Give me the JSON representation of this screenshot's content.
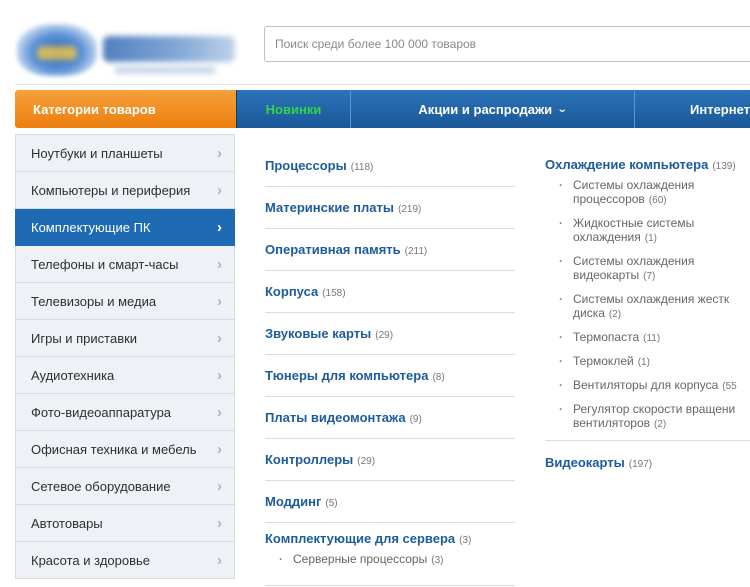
{
  "search": {
    "placeholder": "Поиск среди более 100 000 товаров"
  },
  "nav": {
    "categories": "Категории товаров",
    "new": "Новинки",
    "sales": "Акции и распродажи",
    "internet": "Интернет"
  },
  "sidebar": {
    "items": [
      {
        "label": "Ноутбуки и планшеты",
        "active": false
      },
      {
        "label": "Компьютеры и периферия",
        "active": false
      },
      {
        "label": "Комплектующие ПК",
        "active": true
      },
      {
        "label": "Телефоны и смарт-часы",
        "active": false
      },
      {
        "label": "Телевизоры и медиа",
        "active": false
      },
      {
        "label": "Игры и приставки",
        "active": false
      },
      {
        "label": "Аудиотехника",
        "active": false
      },
      {
        "label": "Фото-видеоаппаратура",
        "active": false
      },
      {
        "label": "Офисная техника и мебель",
        "active": false
      },
      {
        "label": "Сетевое оборудование",
        "active": false
      },
      {
        "label": "Автотовары",
        "active": false
      },
      {
        "label": "Красота и здоровье",
        "active": false
      }
    ]
  },
  "col1": {
    "items": [
      {
        "label": "Процессоры",
        "count": "(118)"
      },
      {
        "label": "Материнские платы",
        "count": "(219)"
      },
      {
        "label": "Оперативная память",
        "count": "(211)"
      },
      {
        "label": "Корпуса",
        "count": "(158)"
      },
      {
        "label": "Звуковые карты",
        "count": "(29)"
      },
      {
        "label": "Тюнеры для компьютера",
        "count": "(8)"
      },
      {
        "label": "Платы видеомонтажа",
        "count": "(9)"
      },
      {
        "label": "Контроллеры",
        "count": "(29)"
      },
      {
        "label": "Моддинг",
        "count": "(5)"
      }
    ],
    "server": {
      "label": "Комплектующие для сервера",
      "count": "(3)",
      "sub_label": "Серверные процессоры",
      "sub_count": "(3)"
    }
  },
  "col2": {
    "cooling": {
      "label": "Охлаждение компьютера",
      "count": "(139)",
      "subs": [
        {
          "l1": "Системы охлаждения",
          "l2": "процессоров",
          "count": "(60)"
        },
        {
          "l1": "Жидкостные системы",
          "l2": "охлаждения",
          "count": "(1)"
        },
        {
          "l1": "Системы охлаждения",
          "l2": "видеокарты",
          "count": "(7)"
        },
        {
          "l1": "Системы охлаждения жестк",
          "l2": "диска",
          "count": "(2)"
        },
        {
          "l1": "Термопаста",
          "l2": "",
          "count": "(11)"
        },
        {
          "l1": "Термоклей",
          "l2": "",
          "count": "(1)"
        },
        {
          "l1": "Вентиляторы для корпуса",
          "l2": "",
          "count": "(55"
        },
        {
          "l1": "Регулятор скорости вращени",
          "l2": "вентиляторов",
          "count": "(2)"
        }
      ]
    },
    "gpu": {
      "label": "Видеокарты",
      "count": "(197)"
    }
  }
}
